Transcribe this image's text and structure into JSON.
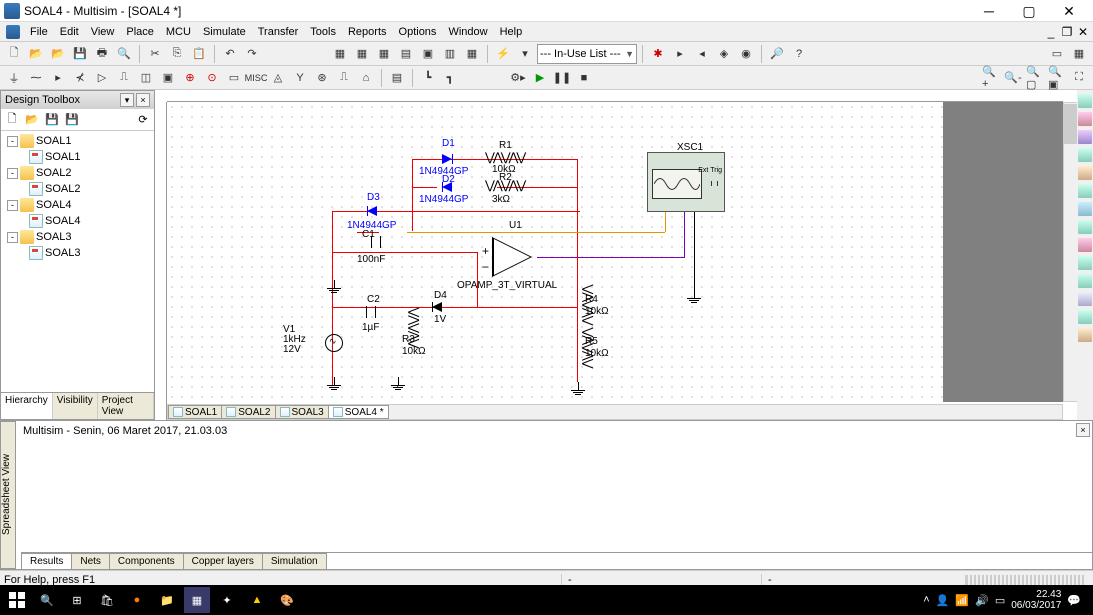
{
  "title": "SOAL4 - Multisim - [SOAL4 *]",
  "menu": [
    "File",
    "Edit",
    "View",
    "Place",
    "MCU",
    "Simulate",
    "Transfer",
    "Tools",
    "Reports",
    "Options",
    "Window",
    "Help"
  ],
  "combo_label": "--- In-Use List ---",
  "sidebar": {
    "title": "Design Toolbox",
    "tree": [
      {
        "exp": "-",
        "label": "SOAL1",
        "children": [
          "SOAL1"
        ]
      },
      {
        "exp": "-",
        "label": "SOAL2",
        "children": [
          "SOAL2"
        ]
      },
      {
        "exp": "-",
        "label": "SOAL4",
        "children": [
          "SOAL4"
        ]
      },
      {
        "exp": "-",
        "label": "SOAL3",
        "children": [
          "SOAL3"
        ]
      }
    ],
    "tabs": [
      "Hierarchy",
      "Visibility",
      "Project View"
    ]
  },
  "canvas_tabs": [
    "SOAL1",
    "SOAL2",
    "SOAL3",
    "SOAL4 *"
  ],
  "circuit": {
    "D1": {
      "name": "D1",
      "part": "1N4944GP"
    },
    "D2": {
      "name": "D2",
      "part": "1N4944GP"
    },
    "D3": {
      "name": "D3",
      "part": "1N4944GP"
    },
    "D4": {
      "name": "D4",
      "val": "1V"
    },
    "R1": {
      "name": "R1",
      "val": "10kΩ"
    },
    "R2": {
      "name": "R2",
      "val": "3kΩ"
    },
    "R3": {
      "name": "R3",
      "val": "10kΩ"
    },
    "R4": {
      "name": "R4",
      "val": "10kΩ"
    },
    "R5": {
      "name": "R5",
      "val": "10kΩ"
    },
    "C1": {
      "name": "C1",
      "val": "100nF"
    },
    "C2": {
      "name": "C2",
      "val": "1µF"
    },
    "U1": {
      "name": "U1",
      "part": "OPAMP_3T_VIRTUAL"
    },
    "V1": {
      "name": "V1",
      "freq": "1kHz",
      "amp": "12V"
    },
    "XSC1": "XSC1",
    "scope_label": "Ext Trig"
  },
  "spreadsheet": {
    "side_label": "Spreadsheet View",
    "text": "Multisim  - Senin, 06 Maret 2017, 21.03.03",
    "tabs": [
      "Results",
      "Nets",
      "Components",
      "Copper layers",
      "Simulation"
    ]
  },
  "status": "For Help, press F1",
  "taskbar": {
    "time": "22.43",
    "date": "06/03/2017"
  }
}
